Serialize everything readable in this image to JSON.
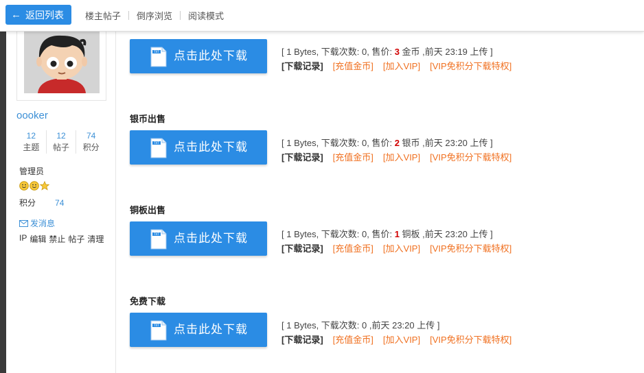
{
  "topbar": {
    "back_label": "返回列表",
    "nav": [
      "楼主帖子",
      "倒序浏览",
      "阅读模式"
    ]
  },
  "user": {
    "name": "oooker",
    "stats": [
      {
        "value": "12",
        "label": "主题"
      },
      {
        "value": "12",
        "label": "帖子"
      },
      {
        "value": "74",
        "label": "积分"
      }
    ],
    "role": "管理员",
    "points_label": "积分",
    "points_value": "74",
    "pm_label": "发消息",
    "admin_links": [
      "IP",
      "编辑",
      "禁止",
      "帖子",
      "清理"
    ]
  },
  "attachments": [
    {
      "title": "",
      "button": "点击此处下载",
      "info_pre": "[ 1 Bytes, 下载次数: 0, 售价: ",
      "price": "3",
      "info_post": " 金币 ,前天 23:19 上传 ]",
      "links": [
        "[下载记录]",
        "[充值金币]",
        "[加入VIP]",
        "[VIP免积分下载特权]"
      ]
    },
    {
      "title": "银币出售",
      "button": "点击此处下载",
      "info_pre": "[ 1 Bytes, 下载次数: 0, 售价: ",
      "price": "2",
      "info_post": " 银币 ,前天 23:20 上传 ]",
      "links": [
        "[下载记录]",
        "[充值金币]",
        "[加入VIP]",
        "[VIP免积分下载特权]"
      ]
    },
    {
      "title": "铜板出售",
      "button": "点击此处下载",
      "info_pre": "[ 1 Bytes, 下载次数: 0, 售价: ",
      "price": "1",
      "info_post": " 铜板 ,前天 23:20 上传 ]",
      "links": [
        "[下载记录]",
        "[充值金币]",
        "[加入VIP]",
        "[VIP免积分下载特权]"
      ]
    },
    {
      "title": "免费下载",
      "button": "点击此处下载",
      "info_pre": "[ 1 Bytes, 下载次数: 0 ,前天 23:20 上传 ]",
      "price": "",
      "info_post": "",
      "links": [
        "[下载记录]",
        "[充值金币]",
        "[加入VIP]",
        "[VIP免积分下载特权]"
      ]
    }
  ],
  "colors": {
    "accent": "#2b8ce4",
    "price": "#d10000",
    "link_orange": "#f07020",
    "user_blue": "#3b8fd6"
  }
}
